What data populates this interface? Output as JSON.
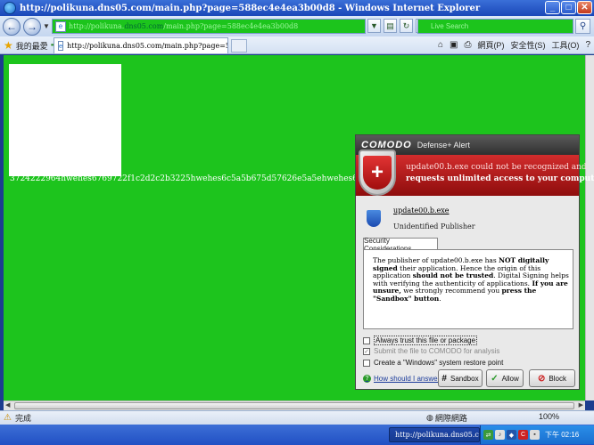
{
  "window": {
    "title": "http://polikuna.dns05.com/main.php?page=588ec4e4ea3b00d8 - Windows Internet Explorer",
    "minimize": "_",
    "maximize": "□",
    "close": "✕"
  },
  "address": {
    "url_prefix": "http://polikuna.",
    "url_domain": "dns05.com",
    "url_rest": "/main.php?page=588ec4e4ea3b00d8",
    "search_placeholder": "Live Search"
  },
  "favorites": {
    "label": "我的最愛"
  },
  "tab": {
    "title": "http://polikuna.dns05.com/main.php?page=588ec4e4ea3b00d8"
  },
  "commandbar": {
    "page": "網頁(P)",
    "safety": "安全性(S)",
    "tools": "工具(O)"
  },
  "content": {
    "hash_text": "3724222964hwehes6769722f1c2d2c2b3225hwehes6c5a5b675d57626e5a5ehwehes675d1f6a"
  },
  "statusbar": {
    "status": "完成",
    "zone": "網際網路",
    "zoom": "100%"
  },
  "taskbar": {
    "item": "http://polikuna.dns05.c...",
    "time": "下午 02:16"
  },
  "comodo": {
    "brand": "COMODO",
    "subtitle": "Defense+ Alert",
    "alert_line1": "update00.b.exe could not be recognized and",
    "alert_line2": "requests unlimited access to your computer",
    "file_name": "update00.b.exe",
    "publisher": "Unidentified Publisher",
    "tab_label": "Security Considerations",
    "desc_part1": "The publisher of update00.b.exe has ",
    "desc_bold1": "NOT digitally signed",
    "desc_part2": " their application. Hence the origin of this application ",
    "desc_bold2": "should not be trusted",
    "desc_part3": ". Digital Signing helps with verifying the authenticity of applications. ",
    "desc_bold3": "If you are unsure,",
    "desc_part4": " we strongly recommend you ",
    "desc_bold4": "press the \"Sandbox\" button",
    "desc_part5": ".",
    "check_trust": "Always trust this file or package",
    "check_submit": "Submit the file to COMODO for analysis",
    "check_restore": "Create a \"Windows\" system restore point",
    "help_link": "How should I answer?",
    "btn_sandbox": "Sandbox",
    "btn_allow": "Allow",
    "btn_block": "Block"
  }
}
